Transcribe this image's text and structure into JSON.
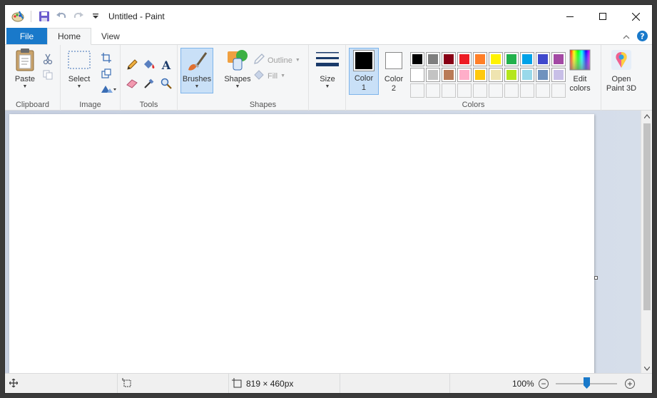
{
  "window": {
    "title": "Untitled - Paint"
  },
  "tabs": {
    "file": "File",
    "home": "Home",
    "view": "View"
  },
  "ribbon": {
    "clipboard": {
      "label": "Clipboard",
      "paste": "Paste"
    },
    "image": {
      "label": "Image",
      "select": "Select"
    },
    "tools": {
      "label": "Tools"
    },
    "brushes": {
      "label": "Brushes"
    },
    "shapes": {
      "label": "Shapes",
      "button": "Shapes",
      "outline": "Outline",
      "fill": "Fill"
    },
    "size": {
      "label": "Size"
    },
    "colors": {
      "label": "Colors",
      "color1": "Color\n1",
      "color2": "Color\n2",
      "edit": "Edit\ncolors",
      "color1_value": "#000000",
      "color2_value": "#ffffff",
      "palette_row1": [
        "#000000",
        "#7f7f7f",
        "#880015",
        "#ed1c24",
        "#ff7f27",
        "#fff200",
        "#22b14c",
        "#00a2e8",
        "#3f48cc",
        "#a349a4"
      ],
      "palette_row2": [
        "#ffffff",
        "#c3c3c3",
        "#b97a57",
        "#ffaec9",
        "#ffc90e",
        "#efe4b0",
        "#b5e61d",
        "#99d9ea",
        "#7092be",
        "#c8bfe7"
      ],
      "palette_row3": [
        "#ffffff",
        "#ffffff",
        "#ffffff",
        "#ffffff",
        "#ffffff",
        "#ffffff",
        "#ffffff",
        "#ffffff",
        "#ffffff",
        "#ffffff"
      ]
    },
    "paint3d": {
      "label": "Open\nPaint 3D"
    }
  },
  "status": {
    "dimensions": "819 × 460px",
    "zoom": "100%",
    "zoom_fraction": 0.5
  },
  "colors": {
    "accent": "#1979ca"
  }
}
